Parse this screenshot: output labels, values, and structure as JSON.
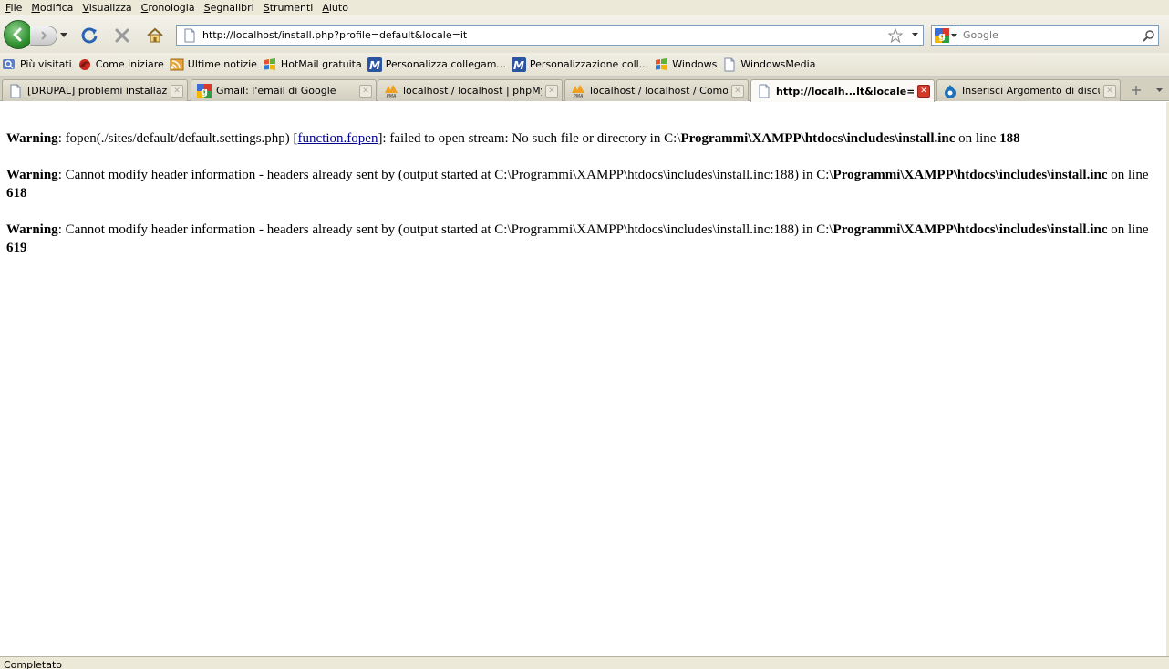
{
  "menu": [
    {
      "label": "File",
      "accel": "F"
    },
    {
      "label": "Modifica",
      "accel": "M"
    },
    {
      "label": "Visualizza",
      "accel": "V"
    },
    {
      "label": "Cronologia",
      "accel": "C"
    },
    {
      "label": "Segnalibri",
      "accel": "S"
    },
    {
      "label": "Strumenti",
      "accel": "S"
    },
    {
      "label": "Aiuto",
      "accel": "A"
    }
  ],
  "toolbar": {
    "url": "http://localhost/install.php?profile=default&locale=it",
    "search_placeholder": "Google"
  },
  "bookmarks": [
    {
      "label": "Più visitati",
      "icon": "most-visited-icon"
    },
    {
      "label": "Come iniziare",
      "icon": "firefox-icon"
    },
    {
      "label": "Ultime notizie",
      "icon": "rss-feed-icon"
    },
    {
      "label": "HotMail gratuita",
      "icon": "windows-flag-icon"
    },
    {
      "label": "Personalizza collegam...",
      "icon": "msn-icon"
    },
    {
      "label": "Personalizzazione coll...",
      "icon": "msn-icon"
    },
    {
      "label": "Windows",
      "icon": "windows-flag-icon"
    },
    {
      "label": "WindowsMedia",
      "icon": "page-icon"
    }
  ],
  "tabs": [
    {
      "label": "[DRUPAL] problemi installazio...",
      "icon": "page-icon",
      "active": false
    },
    {
      "label": "Gmail: l'email di Google",
      "icon": "google-icon",
      "active": false
    },
    {
      "label": "localhost / localhost | phpMyA...",
      "icon": "phpmyadmin-icon",
      "active": false
    },
    {
      "label": "localhost / localhost / Como | ...",
      "icon": "phpmyadmin-icon",
      "active": false
    },
    {
      "label": "http://localh...lt&locale=it",
      "icon": "page-icon",
      "active": true
    },
    {
      "label": "Inserisci Argomento di discuss...",
      "icon": "drupal-icon",
      "active": false
    }
  ],
  "content": {
    "warnings": [
      {
        "label": "Warning",
        "pre": ": fopen(./sites/default/default.settings.php) [",
        "link": "function.fopen",
        "post": "]: failed to open stream: No such file or directory in C:\\",
        "path_bold": "Programmi\\XAMPP\\htdocs\\includes\\install.inc",
        "line_text": " on line ",
        "line": "188"
      },
      {
        "label": "Warning",
        "pre": ": Cannot modify header information - headers already sent by (output started at C:\\Programmi\\XAMPP\\htdocs\\includes\\install.inc:188) in C:\\",
        "path_bold": "Programmi\\XAMPP\\htdocs\\includes\\install.inc",
        "line_text": " on line ",
        "line": "618"
      },
      {
        "label": "Warning",
        "pre": ": Cannot modify header information - headers already sent by (output started at C:\\Programmi\\XAMPP\\htdocs\\includes\\install.inc:188) in C:\\",
        "path_bold": "Programmi\\XAMPP\\htdocs\\includes\\install.inc",
        "line_text": " on line ",
        "line": "619"
      }
    ]
  },
  "status": "Completato"
}
